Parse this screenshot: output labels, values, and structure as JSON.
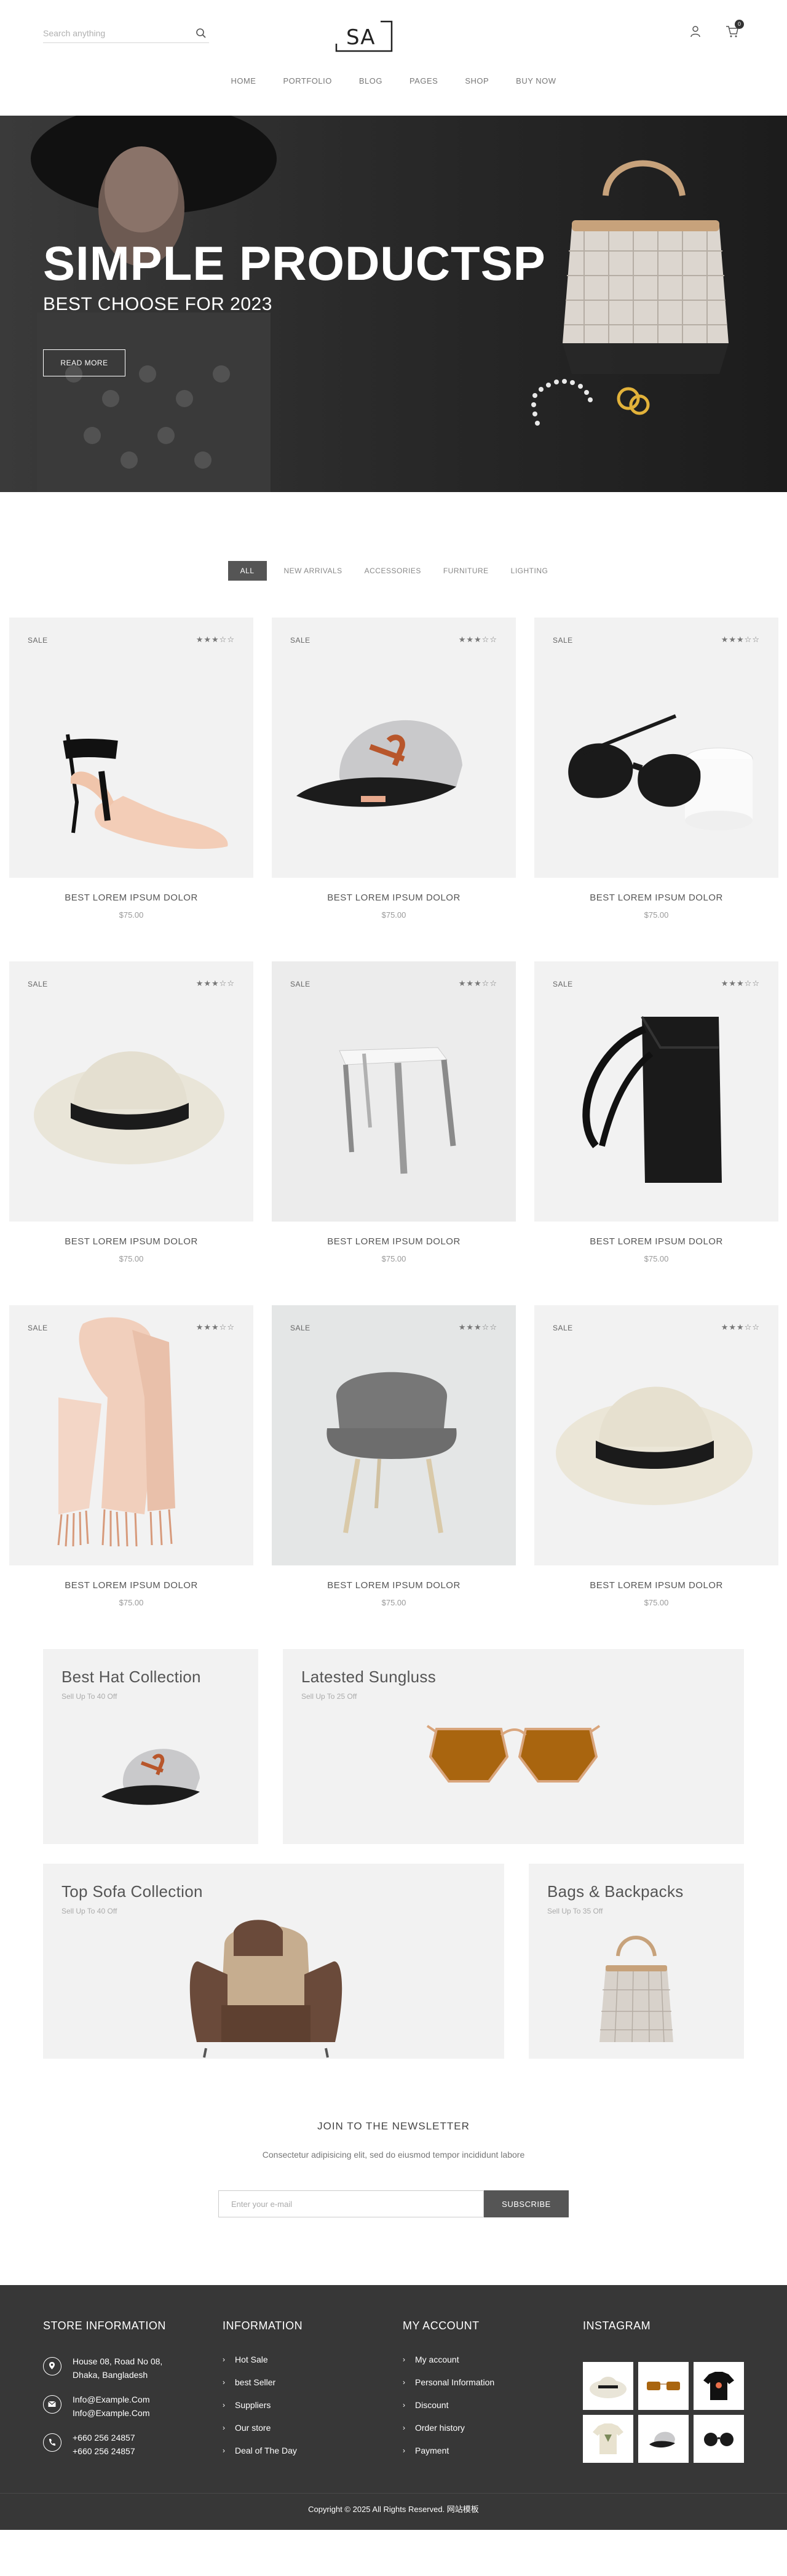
{
  "header": {
    "search_placeholder": "Search anything",
    "logo": "SA",
    "cart_count": "0",
    "nav": [
      "HOME",
      "PORTFOLIO",
      "BLOG",
      "PAGES",
      "SHOP",
      "BUY NOW"
    ]
  },
  "hero": {
    "title": "SIMPLE PRODUCTSP",
    "subtitle": "BEST CHOOSE FOR 2023",
    "button": "READ MORE"
  },
  "filters": [
    "ALL",
    "NEW ARRIVALS",
    "ACCESSORIES",
    "FURNITURE",
    "LIGHTING"
  ],
  "products": [
    {
      "badge": "SALE",
      "rating": "★★★☆☆",
      "name": "BEST LOREM IPSUM DOLOR",
      "price": "$75.00",
      "icon": "high-heel-shoe"
    },
    {
      "badge": "SALE",
      "rating": "★★★☆☆",
      "name": "BEST LOREM IPSUM DOLOR",
      "price": "$75.00",
      "icon": "baseball-cap"
    },
    {
      "badge": "SALE",
      "rating": "★★★☆☆",
      "name": "BEST LOREM IPSUM DOLOR",
      "price": "$75.00",
      "icon": "sunglasses"
    },
    {
      "badge": "SALE",
      "rating": "★★★☆☆",
      "name": "BEST LOREM IPSUM DOLOR",
      "price": "$75.00",
      "icon": "fedora-hat"
    },
    {
      "badge": "SALE",
      "rating": "★★★☆☆",
      "name": "BEST LOREM IPSUM DOLOR",
      "price": "$75.00",
      "icon": "stool"
    },
    {
      "badge": "SALE",
      "rating": "★★★☆☆",
      "name": "BEST LOREM IPSUM DOLOR",
      "price": "$75.00",
      "icon": "backpack"
    },
    {
      "badge": "SALE",
      "rating": "★★★☆☆",
      "name": "BEST LOREM IPSUM DOLOR",
      "price": "$75.00",
      "icon": "scarf"
    },
    {
      "badge": "SALE",
      "rating": "★★★☆☆",
      "name": "BEST LOREM IPSUM DOLOR",
      "price": "$75.00",
      "icon": "chair"
    },
    {
      "badge": "SALE",
      "rating": "★★★☆☆",
      "name": "BEST LOREM IPSUM DOLOR",
      "price": "$75.00",
      "icon": "fedora-hat"
    }
  ],
  "promos": [
    {
      "title": "Best Hat Collection",
      "subtitle": "Sell Up To 40 Off"
    },
    {
      "title": "Latested Sungluss",
      "subtitle": "Sell Up To 25 Off"
    },
    {
      "title": "Top Sofa Collection",
      "subtitle": "Sell Up To 40 Off"
    },
    {
      "title": "Bags & Backpacks",
      "subtitle": "Sell Up To 35 Off"
    }
  ],
  "newsletter": {
    "title": "JOIN TO THE NEWSLETTER",
    "text": "Consectetur adipisicing elit, sed do eiusmod tempor incididunt labore",
    "placeholder": "Enter your e-mail",
    "button": "SUBSCRIBE"
  },
  "footer": {
    "store": {
      "heading": "STORE INFORMATION",
      "address": [
        "House 08, Road No 08,",
        "Dhaka, Bangladesh"
      ],
      "emails": [
        "Info@Example.Com",
        "Info@Example.Com"
      ],
      "phones": [
        "+660 256 24857",
        "+660 256 24857"
      ]
    },
    "information": {
      "heading": "INFORMATION",
      "links": [
        "Hot Sale",
        "best Seller",
        "Suppliers",
        "Our store",
        "Deal of The Day"
      ]
    },
    "account": {
      "heading": "MY ACCOUNT",
      "links": [
        "My account",
        "Personal Information",
        "Discount",
        "Order history",
        "Payment"
      ]
    },
    "instagram": {
      "heading": "INSTAGRAM"
    },
    "copyright": "Copyright © 2025 All Rights Reserved. 网站模板"
  },
  "colors": {
    "dark": "#373737",
    "accent": "#555555",
    "panel": "#f2f2f2"
  }
}
